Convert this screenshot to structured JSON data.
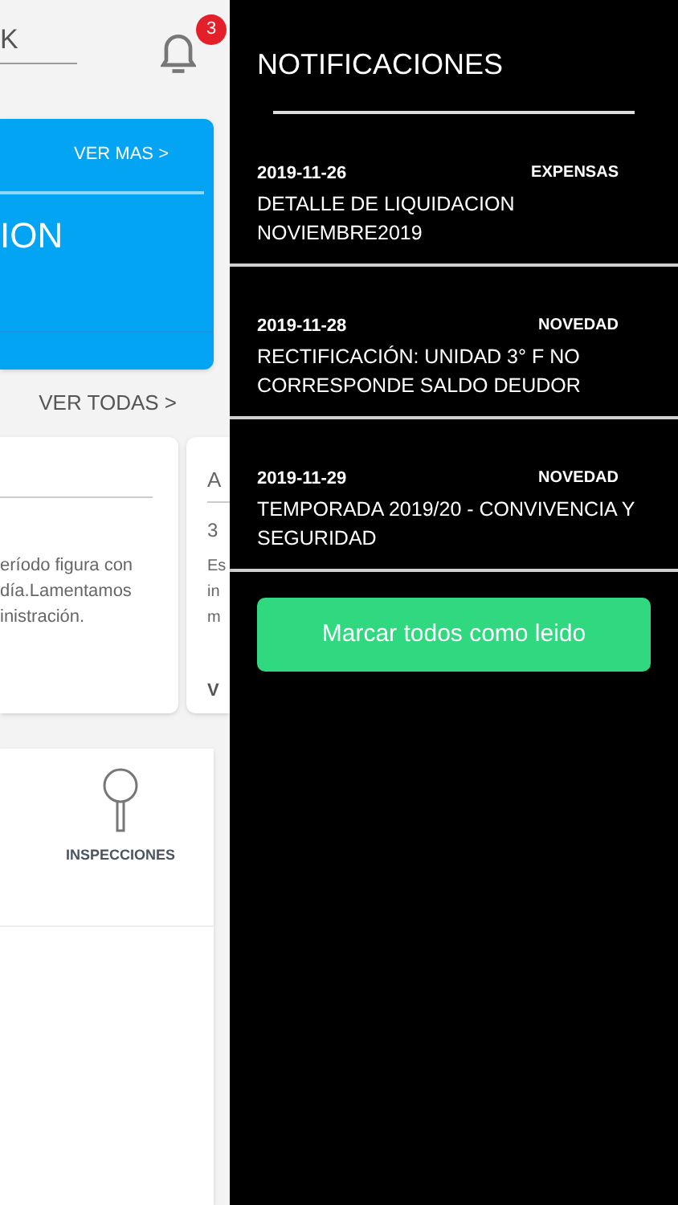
{
  "header": {
    "search_text": "K",
    "badge": "3"
  },
  "banner": {
    "link": "VER MAS >",
    "title": "ION"
  },
  "see_all": "VER TODAS >",
  "cards": [
    {
      "lines": [
        "eríodo figura con",
        "día.Lamentamos",
        "inistración."
      ]
    },
    {
      "title": "A",
      "subtitle": "3",
      "lines": [
        "Es",
        "in",
        "m"
      ],
      "link": "V"
    }
  ],
  "menu": {
    "items": [
      {
        "label": "INSPECCIONES"
      }
    ]
  },
  "drawer": {
    "title": "NOTIFICACIONES",
    "notifications": [
      {
        "date": "2019-11-26",
        "type": "EXPENSAS",
        "title": "DETALLE DE LIQUIDACION NOVIEMBRE2019"
      },
      {
        "date": "2019-11-28",
        "type": "NOVEDAD",
        "title": "RECTIFICACIÓN: UNIDAD 3° F NO CORRESPONDE SALDO DEUDOR"
      },
      {
        "date": "2019-11-29",
        "type": "NOVEDAD",
        "title": "TEMPORADA 2019/20 - CONVIVENCIA Y SEGURIDAD"
      }
    ],
    "button": "Marcar todos como leido"
  }
}
